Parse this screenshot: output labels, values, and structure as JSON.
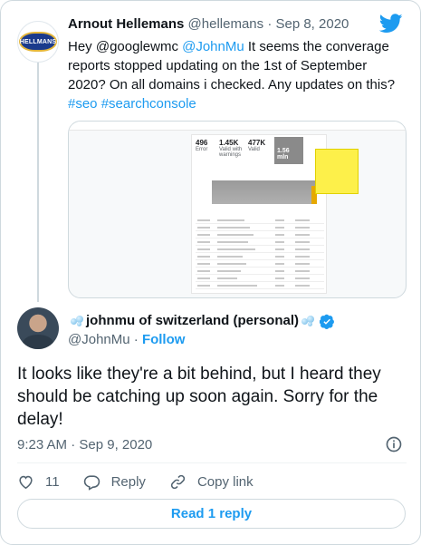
{
  "tweet1": {
    "avatar_text": "HELLMANS",
    "name": "Arnout Hellemans",
    "handle": "@hellemans",
    "separator": "·",
    "date": "Sep 8, 2020",
    "text_parts": {
      "p1": "Hey @googlewmc ",
      "mention": "@JohnMu",
      "p2": " It seems the converage reports stopped updating on the 1st of September 2020? On all domains i checked. Any updates on this? ",
      "hashtags": "#seo #searchconsole"
    },
    "screenshot": {
      "stats": [
        {
          "value": "496",
          "label": "Error"
        },
        {
          "value": "1.45K",
          "label": "Valid with warnings"
        },
        {
          "value": "477K",
          "label": "Valid"
        },
        {
          "value": "1.56 mln",
          "label": "Excluded"
        }
      ]
    }
  },
  "tweet2": {
    "name": "johnmu of switzerland (personal)",
    "handle": "@JohnMu",
    "separator": "·",
    "follow_label": "Follow",
    "text": "It looks like they're a bit behind, but I heard they should be catching up soon again. Sorry for the delay!",
    "timestamp": "9:23 AM · Sep 9, 2020"
  },
  "actions": {
    "like_count": "11",
    "reply_label": "Reply",
    "copy_label": "Copy link"
  },
  "read_replies_label": "Read 1 reply",
  "colors": {
    "twitter_blue": "#1d9bf0",
    "text": "#0f1419",
    "muted": "#536471",
    "highlight_yellow": "#fdf04a"
  }
}
